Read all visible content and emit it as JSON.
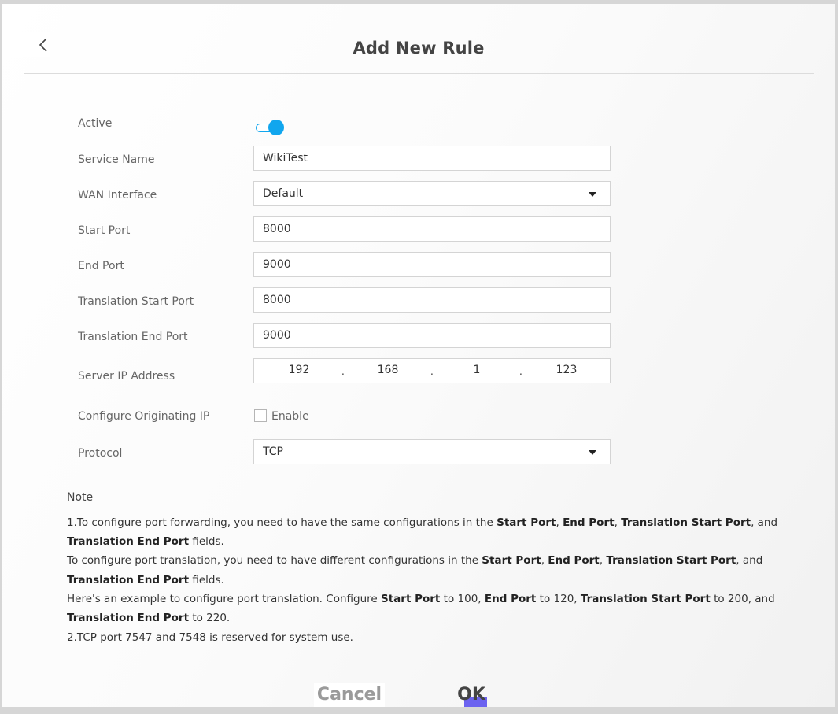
{
  "header": {
    "title": "Add New Rule",
    "back_icon": "chevron-left-icon"
  },
  "form": {
    "active": {
      "label": "Active",
      "on": true
    },
    "service_name": {
      "label": "Service Name",
      "value": "WikiTest"
    },
    "wan_interface": {
      "label": "WAN Interface",
      "value": "Default"
    },
    "start_port": {
      "label": "Start Port",
      "value": "8000"
    },
    "end_port": {
      "label": "End Port",
      "value": "9000"
    },
    "translation_start_port": {
      "label": "Translation Start Port",
      "value": "8000"
    },
    "translation_end_port": {
      "label": "Translation End Port",
      "value": "9000"
    },
    "server_ip": {
      "label": "Server IP Address",
      "octets": [
        "192",
        "168",
        "1",
        "123"
      ],
      "separator": "."
    },
    "originating_ip": {
      "label": "Configure Originating IP",
      "checkbox_label": "Enable",
      "checked": false
    },
    "protocol": {
      "label": "Protocol",
      "value": "TCP"
    }
  },
  "note": {
    "title": "Note",
    "line1a": "1.To configure port forwarding, you need to have the same configurations in the ",
    "start_port": "Start Port",
    "comma": ", ",
    "end_port": "End Port",
    "translation_start_port": "Translation Start Port",
    "and": ", and",
    "translation_end_port": "Translation End Port",
    "fields": " fields.",
    "line3a": "To configure port translation, you need to have different configurations in the ",
    "line5a": "Here's an example to configure port translation. Configure ",
    "to100": " to 100, ",
    "to120": " to 120, ",
    "to200and": " to 200, and",
    "to220": " to 220.",
    "line7": "2.TCP port 7547 and 7548 is reserved for system use."
  },
  "buttons": {
    "cancel": "Cancel",
    "ok": "OK"
  },
  "colors": {
    "accent": "#11a6ee",
    "ok_marker": "#6b62f0"
  }
}
